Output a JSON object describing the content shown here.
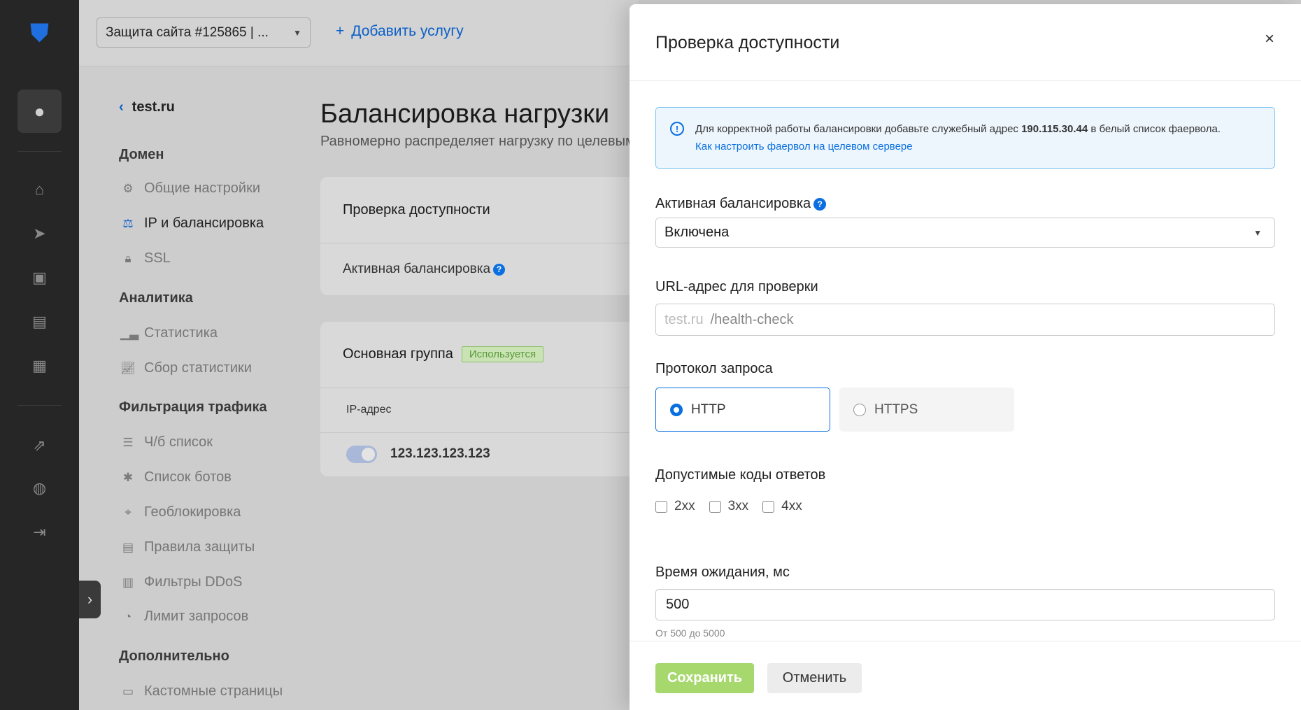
{
  "rail": {
    "icons": [
      "shield-logo-icon",
      "user-icon",
      "home-icon",
      "paper-plane-icon",
      "shopping-bag-icon",
      "document-icon",
      "calendar-icon",
      "external-link-icon",
      "globe-icon",
      "logout-icon"
    ]
  },
  "header": {
    "service_select": "Защита сайта #125865 | ...",
    "add_service": "Добавить услугу"
  },
  "nav": {
    "back": "test.ru",
    "sections": [
      {
        "title": "Домен",
        "items": [
          {
            "label": "Общие настройки",
            "icon": "gear-icon"
          },
          {
            "label": "IP и балансировка",
            "icon": "scales-icon",
            "active": true
          },
          {
            "label": "SSL",
            "icon": "lock-icon"
          }
        ]
      },
      {
        "title": "Аналитика",
        "items": [
          {
            "label": "Статистика",
            "icon": "bar-chart-icon"
          },
          {
            "label": "Сбор статистики",
            "icon": "chart-line-icon"
          }
        ]
      },
      {
        "title": "Фильтрация трафика",
        "items": [
          {
            "label": "Ч/б список",
            "icon": "checklist-icon"
          },
          {
            "label": "Список ботов",
            "icon": "bug-icon"
          },
          {
            "label": "Геоблокировка",
            "icon": "map-pin-icon"
          },
          {
            "label": "Правила защиты",
            "icon": "list-icon"
          },
          {
            "label": "Фильтры DDoS",
            "icon": "barcode-icon"
          },
          {
            "label": "Лимит запросов",
            "icon": "gauge-icon"
          }
        ]
      },
      {
        "title": "Дополнительно",
        "items": [
          {
            "label": "Кастомные страницы",
            "icon": "window-icon"
          }
        ]
      }
    ]
  },
  "main": {
    "title": "Балансировка нагрузки",
    "subtitle": "Равномерно распределяет нагрузку по целевым",
    "card1": {
      "title": "Проверка доступности",
      "row": "Активная балансировка"
    },
    "card2": {
      "title": "Основная группа",
      "badge": "Используется",
      "col": "IP-адрес",
      "ip": "123.123.123.123",
      "ip_enabled": true
    }
  },
  "modal": {
    "title": "Проверка доступности",
    "info": {
      "text_before": "Для корректной работы балансировки добавьте служебный адрес ",
      "ip": "190.115.30.44",
      "text_after": " в белый список фаервола.",
      "link": "Как настроить фаервол на целевом сервере"
    },
    "active_label": "Активная балансировка",
    "active_value": "Включена",
    "url_label": "URL-адрес для проверки",
    "url_prefix": "test.ru",
    "url_placeholder": "/health-check",
    "protocol_label": "Протокол запроса",
    "protocols": [
      {
        "label": "HTTP",
        "selected": true
      },
      {
        "label": "HTTPS",
        "selected": false
      }
    ],
    "codes_label": "Допустимые коды ответов",
    "codes": [
      {
        "label": "2xx",
        "checked": false
      },
      {
        "label": "3xx",
        "checked": false
      },
      {
        "label": "4xx",
        "checked": false
      }
    ],
    "timeout_label": "Время ожидания, мс",
    "timeout_value": "500",
    "timeout_hint": "От 500 до 5000",
    "save": "Сохранить",
    "cancel": "Отменить"
  },
  "colors": {
    "accent": "#0a6fe0",
    "save": "#a6d86e",
    "info_bg": "#eef6fd",
    "info_border": "#7cc4f0",
    "badge_bg": "#c9e3b5",
    "badge_text": "#5b9a3a"
  }
}
